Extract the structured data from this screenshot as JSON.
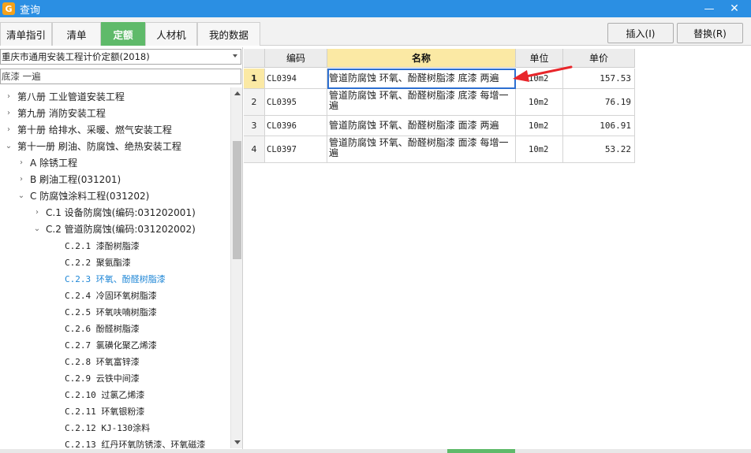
{
  "window": {
    "title": "查询",
    "minimize_glyph": "—",
    "close_glyph": "✕",
    "app_icon_glyph": "G"
  },
  "tabs": [
    {
      "label": "清单指引",
      "active": false
    },
    {
      "label": "清单",
      "active": false
    },
    {
      "label": "定额",
      "active": true
    },
    {
      "label": "人材机",
      "active": false
    },
    {
      "label": "我的数据",
      "active": false
    }
  ],
  "buttons": {
    "insert": "插入(I)",
    "replace": "替换(R)"
  },
  "left": {
    "quota_library": "重庆市通用安装工程计价定额(2018)",
    "search_value": "底漆 一遍",
    "tree": [
      {
        "label": "第八册  工业管道安装工程",
        "expander": "›"
      },
      {
        "label": "第九册  消防安装工程",
        "expander": "›"
      },
      {
        "label": "第十册 给排水、采暖、燃气安装工程",
        "expander": "›"
      },
      {
        "label": "第十一册  刷油、防腐蚀、绝热安装工程",
        "expander": "⌄"
      },
      {
        "label": "A 除锈工程",
        "expander": "›"
      },
      {
        "label": "B 刷油工程(031201)",
        "expander": "›"
      },
      {
        "label": "C 防腐蚀涂料工程(031202)",
        "expander": "⌄"
      },
      {
        "label": "C.1 设备防腐蚀(编码:031202001)",
        "expander": "›"
      },
      {
        "label": "C.2 管道防腐蚀(编码:031202002)",
        "expander": "⌄"
      },
      {
        "label": "C.2.1 漆酚树脂漆",
        "expander": ""
      },
      {
        "label": "C.2.2 聚氨酯漆",
        "expander": ""
      },
      {
        "label": "C.2.3 环氧、酚醛树脂漆",
        "expander": "",
        "selected": true
      },
      {
        "label": "C.2.4 冷固环氧树脂漆",
        "expander": ""
      },
      {
        "label": "C.2.5 环氧呋喃树脂漆",
        "expander": ""
      },
      {
        "label": "C.2.6 酚醛树脂漆",
        "expander": ""
      },
      {
        "label": "C.2.7 氯磺化聚乙烯漆",
        "expander": ""
      },
      {
        "label": "C.2.8 环氧富锌漆",
        "expander": ""
      },
      {
        "label": "C.2.9 云铁中间漆",
        "expander": ""
      },
      {
        "label": "C.2.10 过氯乙烯漆",
        "expander": ""
      },
      {
        "label": "C.2.11 环氧银粉漆",
        "expander": ""
      },
      {
        "label": "C.2.12 KJ-130涂料",
        "expander": ""
      },
      {
        "label": "C.2.13 红丹环氧防锈漆、环氧磁漆",
        "expander": ""
      }
    ]
  },
  "grid": {
    "columns": [
      "编码",
      "名称",
      "单位",
      "单价"
    ],
    "rows": [
      {
        "num": "1",
        "code": "CL0394",
        "name": "管道防腐蚀 环氧、酚醛树脂漆 底漆 两遍",
        "unit": "10m2",
        "price": "157.53"
      },
      {
        "num": "2",
        "code": "CL0395",
        "name": "管道防腐蚀 环氧、酚醛树脂漆 底漆 每增一遍",
        "unit": "10m2",
        "price": "76.19"
      },
      {
        "num": "3",
        "code": "CL0396",
        "name": "管道防腐蚀 环氧、酚醛树脂漆 面漆 两遍",
        "unit": "10m2",
        "price": "106.91"
      },
      {
        "num": "4",
        "code": "CL0397",
        "name": "管道防腐蚀 环氧、酚醛树脂漆 面漆 每增一遍",
        "unit": "10m2",
        "price": "53.22"
      }
    ]
  },
  "colors": {
    "title_bar": "#2b8fe3",
    "active_tab": "#5fba6a",
    "name_header": "#fbe9a4",
    "selected_tree": "#1e86d6",
    "annotation_arrow": "#e8262b"
  }
}
